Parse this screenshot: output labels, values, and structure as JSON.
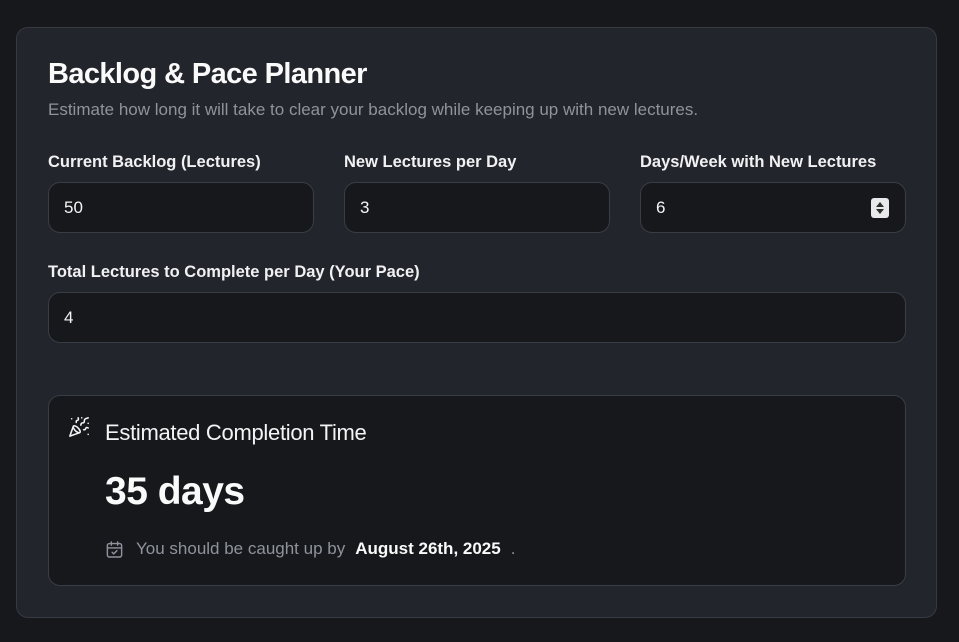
{
  "planner": {
    "title": "Backlog & Pace Planner",
    "subtitle": "Estimate how long it will take to clear your backlog while keeping up with new lectures."
  },
  "fields": {
    "backlog": {
      "label": "Current Backlog (Lectures)",
      "value": "50"
    },
    "new_per_day": {
      "label": "New Lectures per Day",
      "value": "3"
    },
    "days_per_week": {
      "label": "Days/Week with New Lectures",
      "value": "6"
    },
    "pace": {
      "label": "Total Lectures to Complete per Day (Your Pace)",
      "value": "4"
    }
  },
  "result": {
    "icon": "party-popper-icon",
    "title": "Estimated Completion Time",
    "value": "35 days",
    "line_prefix": "You should be caught up by",
    "date": "August 26th, 2025",
    "line_suffix": ".",
    "line_icon": "calendar-check-icon"
  },
  "colors": {
    "page_bg": "#17181c",
    "card_bg": "#22252b",
    "input_bg": "#17181c",
    "border": "#393d45",
    "muted_text": "#8e939c",
    "text": "#f4f4f5"
  }
}
